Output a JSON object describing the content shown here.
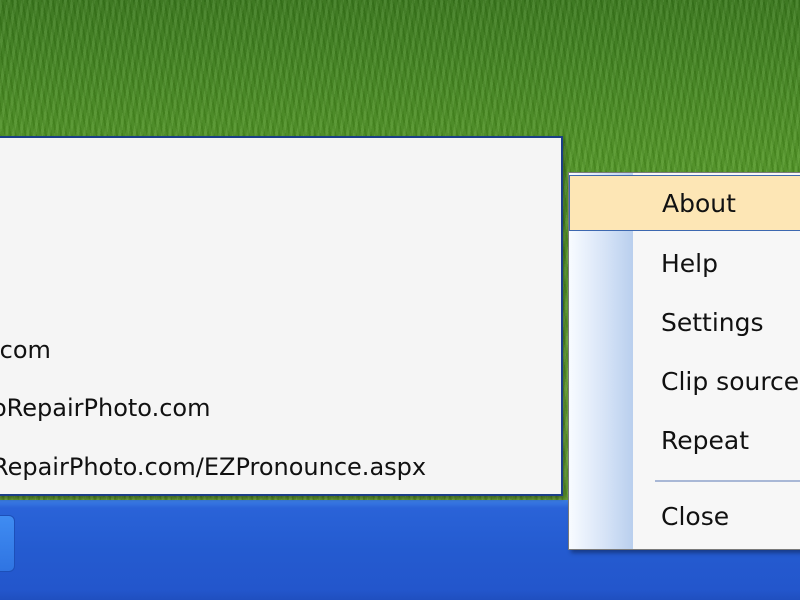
{
  "info_window": {
    "lines": [
      ".com",
      "oRepairPhoto.com",
      "RepairPhoto.com/EZPronounce.aspx"
    ]
  },
  "context_menu": {
    "items": [
      {
        "label": "About",
        "highlighted": true
      },
      {
        "label": "Help"
      },
      {
        "label": "Settings"
      },
      {
        "label": "Clip source"
      },
      {
        "label": "Repeat"
      },
      {
        "label": "Close"
      }
    ]
  },
  "colors": {
    "taskbar": "#245bd0",
    "menu_highlight": "#fde6b5",
    "menu_highlight_border": "#3d68b0",
    "window_background": "#f5f5f5"
  }
}
